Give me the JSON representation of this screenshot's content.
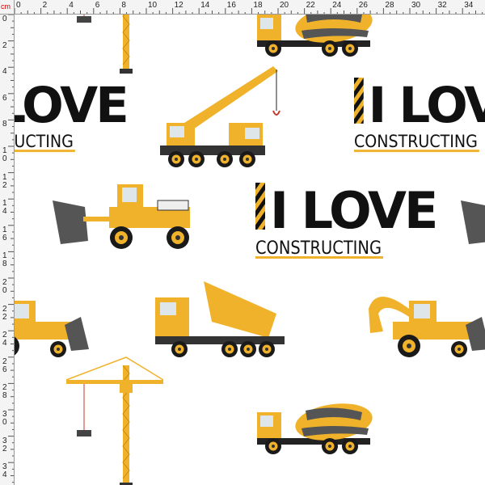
{
  "ruler": {
    "unit": "cm",
    "top_labels": [
      "0",
      "2",
      "4",
      "6",
      "8",
      "10",
      "12",
      "14",
      "16",
      "18",
      "20",
      "22",
      "24",
      "26",
      "28",
      "30",
      "32",
      "34"
    ],
    "left_labels": [
      "0",
      "2",
      "4",
      "6",
      "8",
      "10",
      "12",
      "14",
      "16",
      "18",
      "20",
      "22",
      "24",
      "26",
      "28",
      "30",
      "32",
      "34"
    ]
  },
  "pattern": {
    "slogan_big": "I LOVE",
    "slogan_small": "CONSTRUCTING",
    "colors": {
      "yellow": "#f0b22a",
      "black": "#111111",
      "gray": "#555555",
      "white": "#ffffff"
    }
  }
}
